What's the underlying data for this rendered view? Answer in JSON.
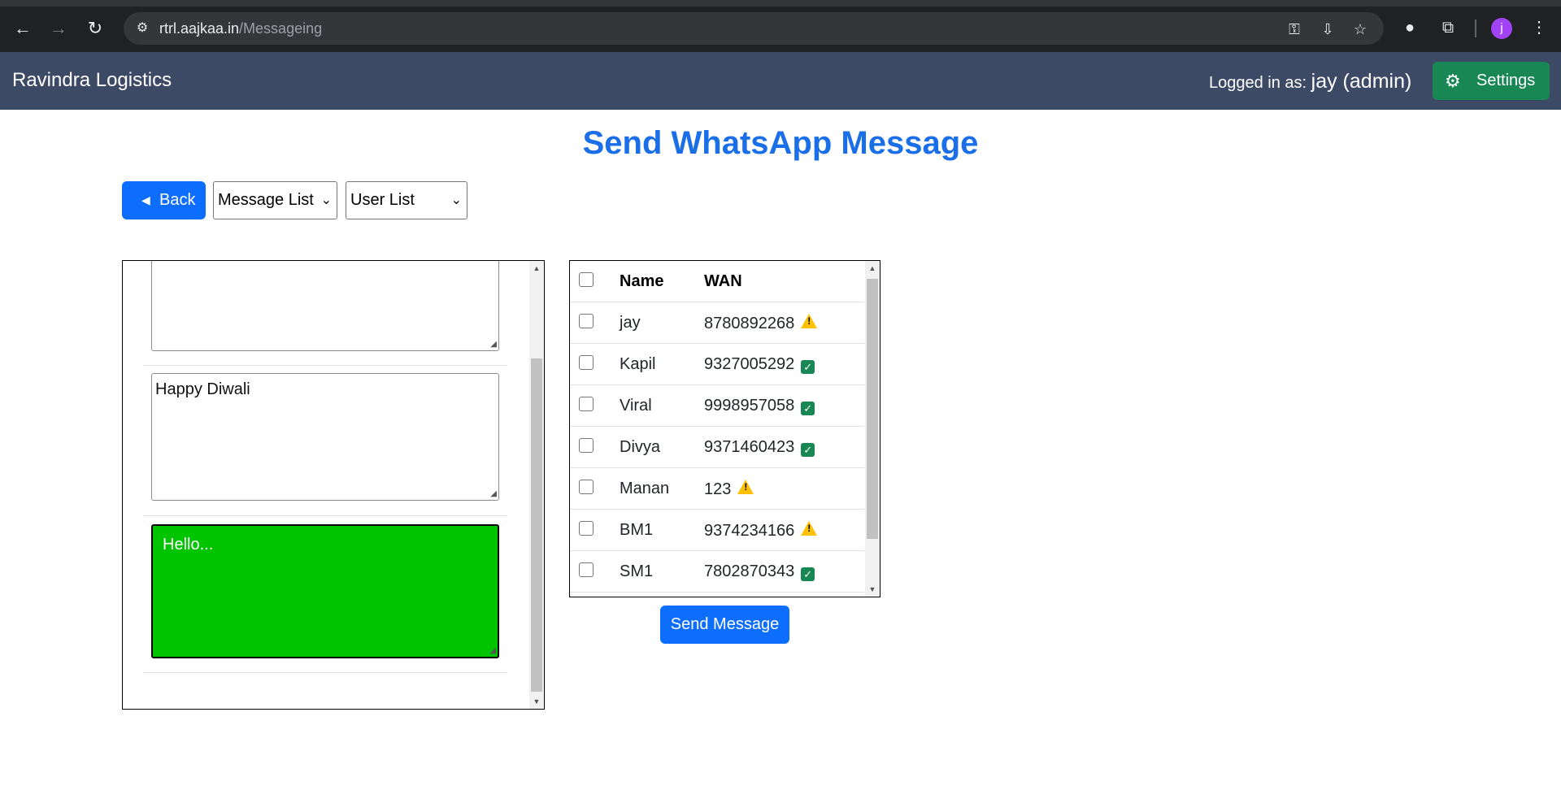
{
  "browser": {
    "url_host": "rtrl.aajkaa.in",
    "url_path": "/Messageing",
    "profile_initial": "j"
  },
  "navbar": {
    "brand": "Ravindra Logistics",
    "logged_prefix": "Logged in as: ",
    "logged_user": "jay (admin)",
    "settings_label": "Settings"
  },
  "page": {
    "title": "Send WhatsApp Message",
    "back_label": "Back",
    "message_select": "Message List",
    "user_select": "User List",
    "send_label": "Send Message"
  },
  "messages": [
    {
      "text": "",
      "selected": false
    },
    {
      "text": "Happy Diwali",
      "selected": false
    },
    {
      "text": "Hello...",
      "selected": true
    }
  ],
  "user_table": {
    "columns": [
      "Name",
      "WAN"
    ],
    "rows": [
      {
        "name": "jay",
        "wan": "8780892268",
        "status": "warning"
      },
      {
        "name": "Kapil",
        "wan": "9327005292",
        "status": "verified"
      },
      {
        "name": "Viral",
        "wan": "9998957058",
        "status": "verified"
      },
      {
        "name": "Divya",
        "wan": "9371460423",
        "status": "verified"
      },
      {
        "name": "Manan",
        "wan": "123",
        "status": "warning"
      },
      {
        "name": "BM1",
        "wan": "9374234166",
        "status": "warning"
      },
      {
        "name": "SM1",
        "wan": "7802870343",
        "status": "verified"
      }
    ]
  },
  "colors": {
    "navbar": "#3d4a66",
    "primary": "#0d6efd",
    "success": "#198754",
    "selected_message": "#00c400",
    "title": "#1a6fe8",
    "warning": "#ffc107"
  }
}
